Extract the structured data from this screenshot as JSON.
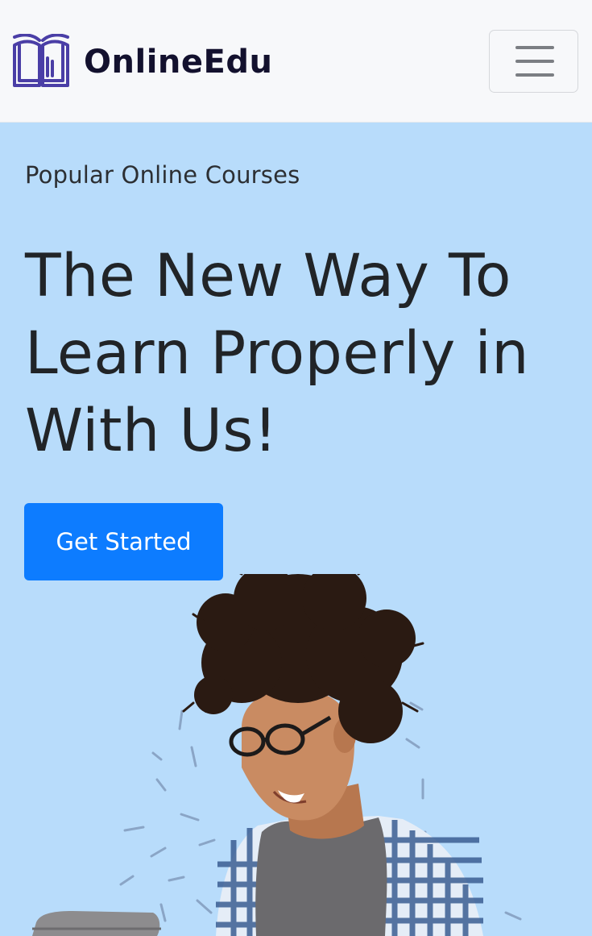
{
  "navbar": {
    "brand_name": "OnlineEdu",
    "logo_icon": "open-book-icon",
    "toggler_icon": "hamburger-menu-icon"
  },
  "hero": {
    "subtitle": "Popular Online Courses",
    "title": "The New Way To Learn Properly in With Us!",
    "cta_label": "Get Started",
    "image": "student-with-glasses-holding-laptop"
  },
  "colors": {
    "navbar_bg": "#f7f8fa",
    "hero_bg": "#b8dcfb",
    "primary": "#0d7cff",
    "brand_text": "#13112e",
    "logo": "#5b4fb3"
  }
}
